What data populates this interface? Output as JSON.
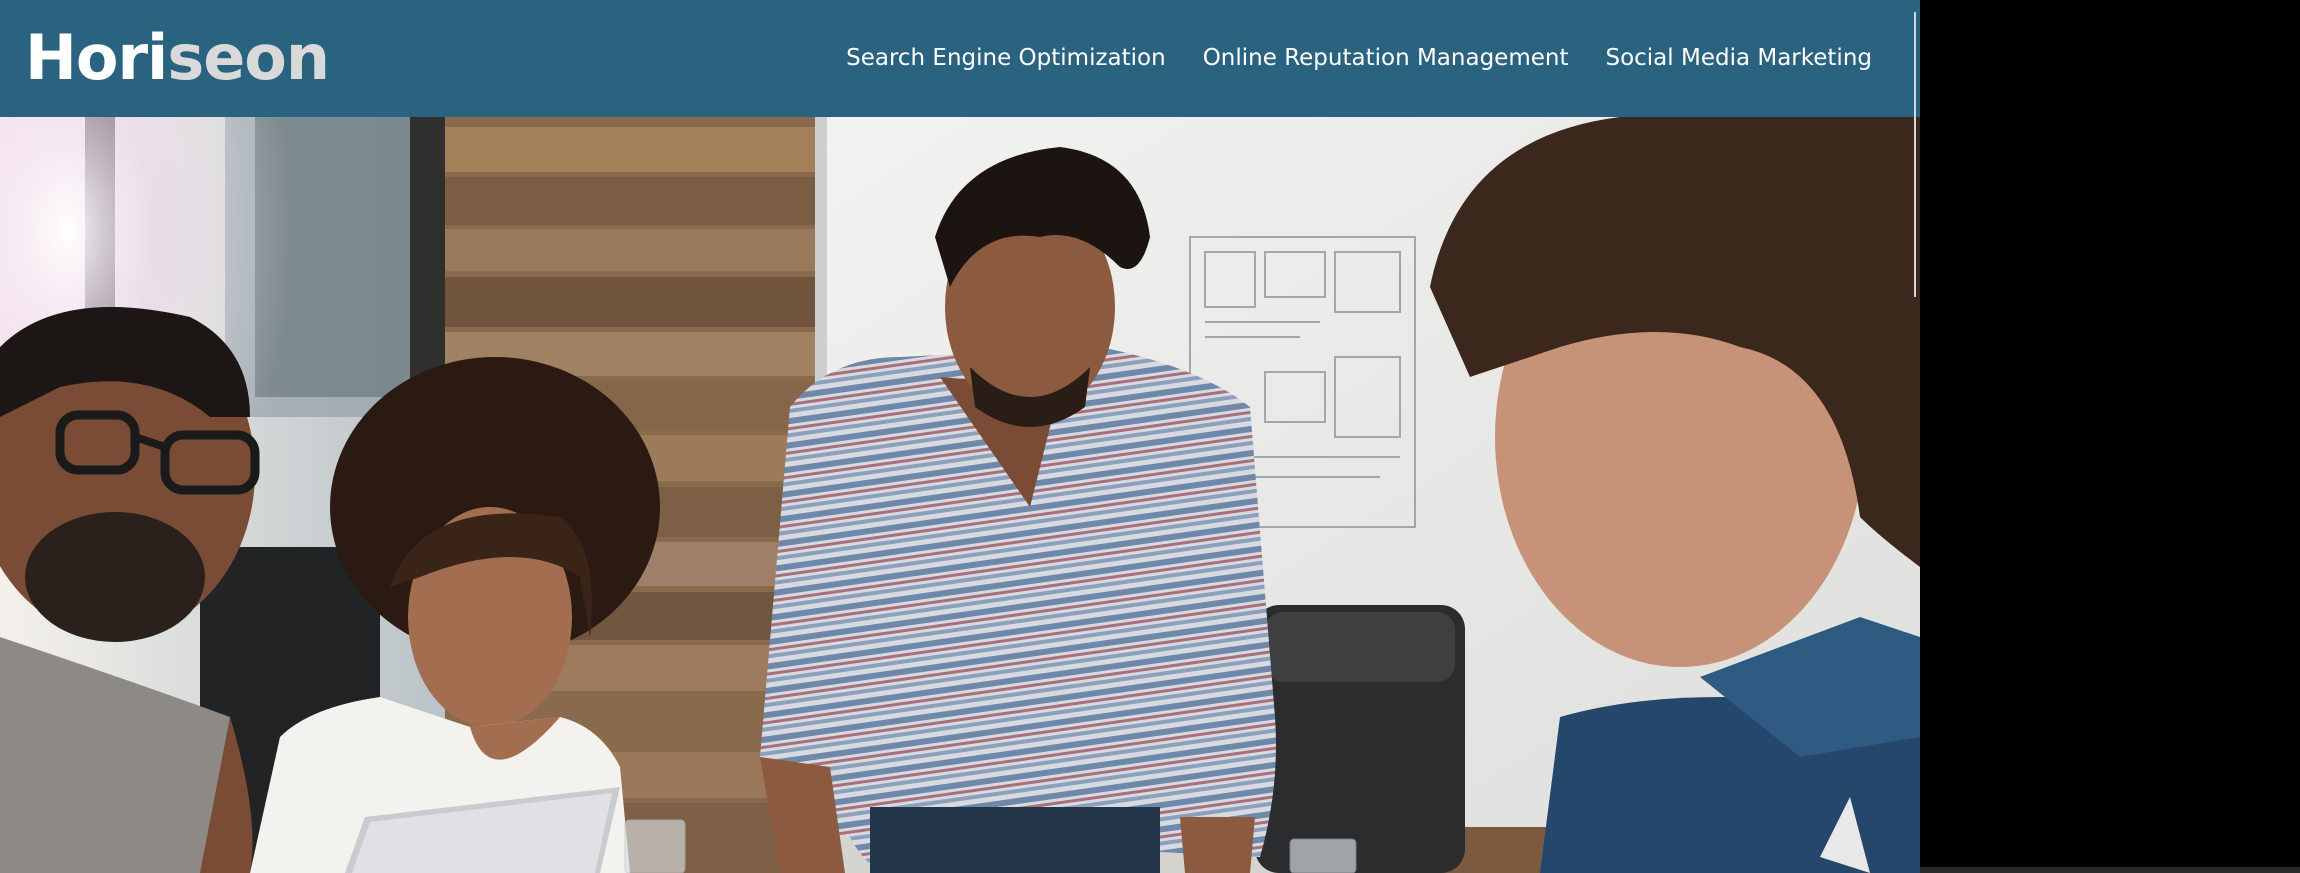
{
  "header": {
    "logo_part1": "Hori",
    "logo_part2": "seon"
  },
  "nav": {
    "items": [
      {
        "label": "Search Engine Optimization"
      },
      {
        "label": "Online Reputation Management"
      },
      {
        "label": "Social Media Marketing"
      }
    ]
  },
  "colors": {
    "header_bg": "#2a637f",
    "logo_primary": "#ffffff",
    "logo_secondary": "#d9d9d9",
    "nav_text": "#ffffff"
  },
  "hero": {
    "image": "team-meeting-photo"
  }
}
